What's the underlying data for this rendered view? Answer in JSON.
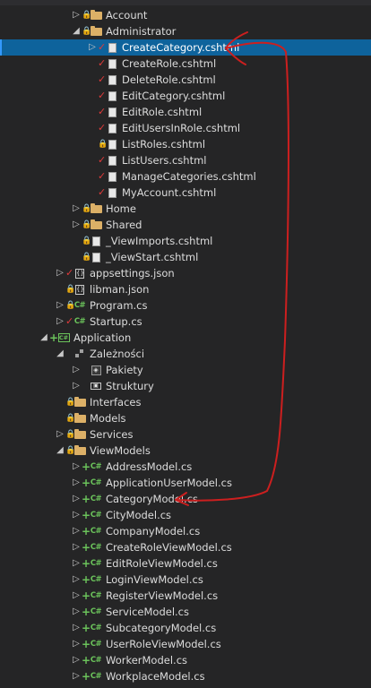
{
  "tree": [
    {
      "depth": 3,
      "expander": "collapsed",
      "status": "lock",
      "icon": "folder",
      "label": "Account"
    },
    {
      "depth": 3,
      "expander": "expanded",
      "status": "lock",
      "icon": "folder",
      "label": "Administrator"
    },
    {
      "depth": 4,
      "expander": "collapsed",
      "status": "check",
      "icon": "page",
      "label": "CreateCategory.cshtml",
      "selected": true
    },
    {
      "depth": 4,
      "expander": "none",
      "status": "check",
      "icon": "page",
      "label": "CreateRole.cshtml"
    },
    {
      "depth": 4,
      "expander": "none",
      "status": "check",
      "icon": "page",
      "label": "DeleteRole.cshtml"
    },
    {
      "depth": 4,
      "expander": "none",
      "status": "check",
      "icon": "page",
      "label": "EditCategory.cshtml"
    },
    {
      "depth": 4,
      "expander": "none",
      "status": "check",
      "icon": "page",
      "label": "EditRole.cshtml"
    },
    {
      "depth": 4,
      "expander": "none",
      "status": "check",
      "icon": "page",
      "label": "EditUsersInRole.cshtml"
    },
    {
      "depth": 4,
      "expander": "none",
      "status": "lock",
      "icon": "page",
      "label": "ListRoles.cshtml"
    },
    {
      "depth": 4,
      "expander": "none",
      "status": "check",
      "icon": "page",
      "label": "ListUsers.cshtml"
    },
    {
      "depth": 4,
      "expander": "none",
      "status": "check",
      "icon": "page",
      "label": "ManageCategories.cshtml"
    },
    {
      "depth": 4,
      "expander": "none",
      "status": "check",
      "icon": "page",
      "label": "MyAccount.cshtml"
    },
    {
      "depth": 3,
      "expander": "collapsed",
      "status": "lock",
      "icon": "folder",
      "label": "Home"
    },
    {
      "depth": 3,
      "expander": "collapsed",
      "status": "lock",
      "icon": "folder",
      "label": "Shared"
    },
    {
      "depth": 3,
      "expander": "none",
      "status": "lock",
      "icon": "page",
      "label": "_ViewImports.cshtml"
    },
    {
      "depth": 3,
      "expander": "none",
      "status": "lock",
      "icon": "page",
      "label": "_ViewStart.cshtml"
    },
    {
      "depth": 2,
      "expander": "collapsed",
      "status": "check",
      "icon": "json",
      "label": "appsettings.json"
    },
    {
      "depth": 2,
      "expander": "none",
      "status": "lock",
      "icon": "json",
      "label": "libman.json"
    },
    {
      "depth": 2,
      "expander": "collapsed",
      "status": "lock",
      "icon": "cs",
      "label": "Program.cs"
    },
    {
      "depth": 2,
      "expander": "collapsed",
      "status": "check",
      "icon": "cs",
      "label": "Startup.cs"
    },
    {
      "depth": 1,
      "expander": "expanded",
      "status": "plus",
      "icon": "project",
      "label": "Application"
    },
    {
      "depth": 2,
      "expander": "expanded",
      "status": "none",
      "icon": "deps",
      "label": "Zależności"
    },
    {
      "depth": 3,
      "expander": "collapsed",
      "status": "none",
      "icon": "package",
      "label": "Pakiety"
    },
    {
      "depth": 3,
      "expander": "collapsed",
      "status": "none",
      "icon": "framework",
      "label": "Struktury"
    },
    {
      "depth": 2,
      "expander": "none",
      "status": "lock",
      "icon": "folder",
      "label": "Interfaces"
    },
    {
      "depth": 2,
      "expander": "none",
      "status": "lock",
      "icon": "folder",
      "label": "Models"
    },
    {
      "depth": 2,
      "expander": "collapsed",
      "status": "lock",
      "icon": "folder",
      "label": "Services"
    },
    {
      "depth": 2,
      "expander": "expanded",
      "status": "lock",
      "icon": "folder",
      "label": "ViewModels"
    },
    {
      "depth": 3,
      "expander": "collapsed",
      "status": "plus",
      "icon": "cs",
      "label": "AddressModel.cs"
    },
    {
      "depth": 3,
      "expander": "collapsed",
      "status": "plus",
      "icon": "cs",
      "label": "ApplicationUserModel.cs"
    },
    {
      "depth": 3,
      "expander": "collapsed",
      "status": "plus",
      "icon": "cs",
      "label": "CategoryModel.cs"
    },
    {
      "depth": 3,
      "expander": "collapsed",
      "status": "plus",
      "icon": "cs",
      "label": "CityModel.cs"
    },
    {
      "depth": 3,
      "expander": "collapsed",
      "status": "plus",
      "icon": "cs",
      "label": "CompanyModel.cs"
    },
    {
      "depth": 3,
      "expander": "collapsed",
      "status": "plus",
      "icon": "cs",
      "label": "CreateRoleViewModel.cs"
    },
    {
      "depth": 3,
      "expander": "collapsed",
      "status": "plus",
      "icon": "cs",
      "label": "EditRoleViewModel.cs"
    },
    {
      "depth": 3,
      "expander": "collapsed",
      "status": "plus",
      "icon": "cs",
      "label": "LoginViewModel.cs"
    },
    {
      "depth": 3,
      "expander": "collapsed",
      "status": "plus",
      "icon": "cs",
      "label": "RegisterViewModel.cs"
    },
    {
      "depth": 3,
      "expander": "collapsed",
      "status": "plus",
      "icon": "cs",
      "label": "ServiceModel.cs"
    },
    {
      "depth": 3,
      "expander": "collapsed",
      "status": "plus",
      "icon": "cs",
      "label": "SubcategoryModel.cs"
    },
    {
      "depth": 3,
      "expander": "collapsed",
      "status": "plus",
      "icon": "cs",
      "label": "UserRoleViewModel.cs"
    },
    {
      "depth": 3,
      "expander": "collapsed",
      "status": "plus",
      "icon": "cs",
      "label": "WorkerModel.cs"
    },
    {
      "depth": 3,
      "expander": "collapsed",
      "status": "plus",
      "icon": "cs",
      "label": "WorkplaceModel.cs"
    }
  ],
  "icons": {
    "expander_collapsed": "▷",
    "expander_expanded": "◢",
    "status_lock": "🔒",
    "status_check": "✓",
    "status_plus": "+",
    "cs_glyph": "C#",
    "json_glyph": "{}",
    "project_glyph": "C#",
    "package_glyph": "◈",
    "framework_glyph": "▣"
  },
  "colors": {
    "background": "#252526",
    "selection": "#0e639c",
    "annotation": "#cc1f1f"
  }
}
